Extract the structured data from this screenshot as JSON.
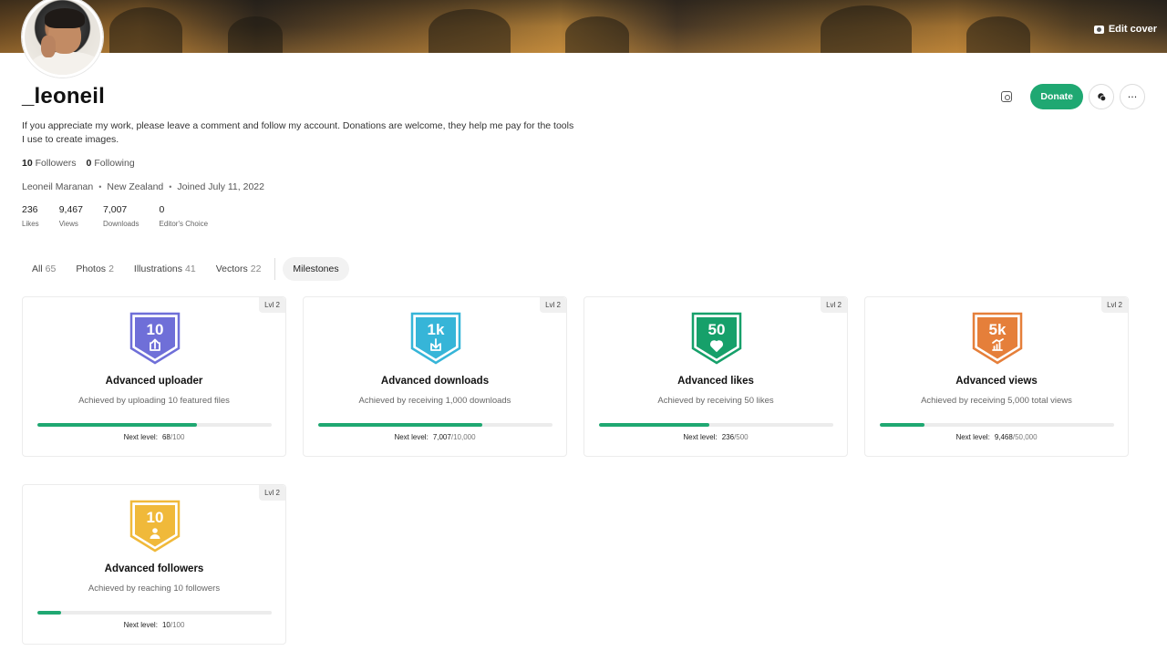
{
  "cover": {
    "edit_label": "Edit cover"
  },
  "profile": {
    "username": "_leoneil",
    "bio": "If you appreciate my work, please leave a comment and follow my account. Donations are welcome, they help me pay for the tools I use to create images.",
    "followers_count": "10",
    "followers_label": "Followers",
    "following_count": "0",
    "following_label": "Following",
    "full_name": "Leoneil Maranan",
    "location": "New Zealand",
    "joined": "Joined July 11, 2022"
  },
  "stats": [
    {
      "value": "236",
      "label": "Likes"
    },
    {
      "value": "9,467",
      "label": "Views"
    },
    {
      "value": "7,007",
      "label": "Downloads"
    },
    {
      "value": "0",
      "label": "Editor's Choice"
    }
  ],
  "actions": {
    "donate_label": "Donate",
    "more_label": "···",
    "instagram_icon": "instagram-icon",
    "message_icon": "chat-icon"
  },
  "tabs": [
    {
      "label": "All",
      "count": "65"
    },
    {
      "label": "Photos",
      "count": "2"
    },
    {
      "label": "Illustrations",
      "count": "41"
    },
    {
      "label": "Vectors",
      "count": "22"
    },
    {
      "label": "Milestones",
      "count": ""
    }
  ],
  "milestones": [
    {
      "level": "Lvl 2",
      "badge_text": "10",
      "color": "#6f6fd8",
      "icon": "upload-icon",
      "title": "Advanced uploader",
      "desc": "Achieved by uploading 10 featured files",
      "next_label": "Next level:",
      "current": "68",
      "max": "/100",
      "progress": 0.68
    },
    {
      "level": "Lvl 2",
      "badge_text": "1k",
      "color": "#36b5d8",
      "icon": "download-icon",
      "title": "Advanced downloads",
      "desc": "Achieved by receiving 1,000 downloads",
      "next_label": "Next level:",
      "current": "7,007",
      "max": "/10,000",
      "progress": 0.7
    },
    {
      "level": "Lvl 2",
      "badge_text": "50",
      "color": "#16a06a",
      "icon": "heart-icon",
      "title": "Advanced likes",
      "desc": "Achieved by receiving 50 likes",
      "next_label": "Next level:",
      "current": "236",
      "max": "/500",
      "progress": 0.472
    },
    {
      "level": "Lvl 2",
      "badge_text": "5k",
      "color": "#e57f3a",
      "icon": "chart-icon",
      "title": "Advanced views",
      "desc": "Achieved by receiving 5,000 total views",
      "next_label": "Next level:",
      "current": "9,468",
      "max": "/50,000",
      "progress": 0.19
    },
    {
      "level": "Lvl 2",
      "badge_text": "10",
      "color": "#f0b93a",
      "icon": "user-icon",
      "title": "Advanced followers",
      "desc": "Achieved by reaching 10 followers",
      "next_label": "Next level:",
      "current": "10",
      "max": "/100",
      "progress": 0.1
    }
  ]
}
